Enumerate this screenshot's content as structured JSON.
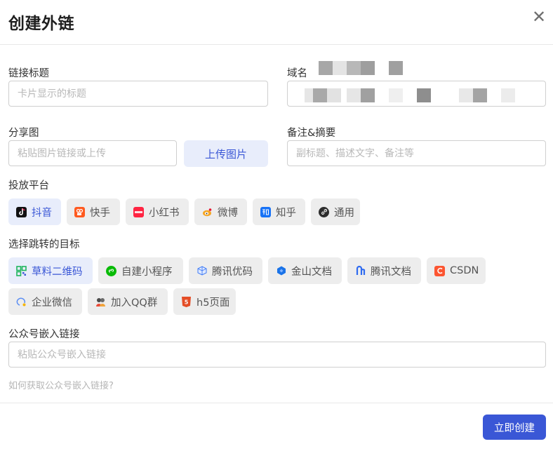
{
  "dialog": {
    "title": "创建外链",
    "close_glyph": "✕"
  },
  "form": {
    "link_title": {
      "label": "链接标题",
      "placeholder": "卡片显示的标题"
    },
    "domain": {
      "label": "域名"
    },
    "share_image": {
      "label": "分享图",
      "placeholder": "粘贴图片链接或上传",
      "upload_label": "上传图片"
    },
    "note": {
      "label": "备注&摘要",
      "placeholder": "副标题、描述文字、备注等"
    },
    "platform": {
      "label": "投放平台",
      "items": [
        {
          "label": "抖音",
          "icon": "douyin-icon",
          "selected": true
        },
        {
          "label": "快手",
          "icon": "kuaishou-icon",
          "selected": false
        },
        {
          "label": "小红书",
          "icon": "xiaohongshu-icon",
          "selected": false
        },
        {
          "label": "微博",
          "icon": "weibo-icon",
          "selected": false
        },
        {
          "label": "知乎",
          "icon": "zhihu-icon",
          "selected": false
        },
        {
          "label": "通用",
          "icon": "link-icon",
          "selected": false
        }
      ]
    },
    "target": {
      "label": "选择跳转的目标",
      "items": [
        {
          "label": "草料二维码",
          "icon": "qrcode-icon",
          "selected": true
        },
        {
          "label": "自建小程序",
          "icon": "miniprogram-icon",
          "selected": false
        },
        {
          "label": "腾讯优码",
          "icon": "tencent-youma-icon",
          "selected": false
        },
        {
          "label": "金山文档",
          "icon": "kdocs-icon",
          "selected": false
        },
        {
          "label": "腾讯文档",
          "icon": "tencent-docs-icon",
          "selected": false
        },
        {
          "label": "CSDN",
          "icon": "csdn-icon",
          "selected": false
        },
        {
          "label": "企业微信",
          "icon": "wecom-icon",
          "selected": false
        },
        {
          "label": "加入QQ群",
          "icon": "qq-group-icon",
          "selected": false
        },
        {
          "label": "h5页面",
          "icon": "html5-icon",
          "selected": false
        }
      ]
    },
    "article_embed": {
      "label": "公众号嵌入链接",
      "placeholder": "粘贴公众号嵌入链接"
    },
    "help_link": "如何获取公众号嵌入链接?"
  },
  "footer": {
    "submit_label": "立即创建"
  },
  "colors": {
    "accent": "#3a57d6",
    "selected_bg": "#e8edfb",
    "chip_bg": "#ededed"
  }
}
